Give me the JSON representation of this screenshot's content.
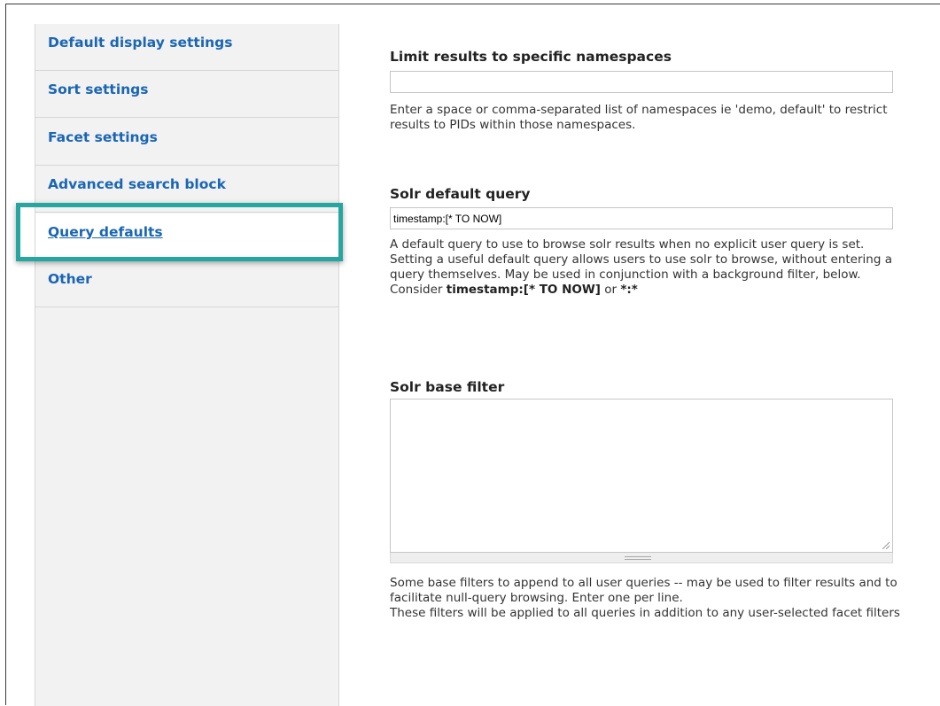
{
  "sidebar": {
    "items": [
      {
        "label": "Default display settings",
        "active": false
      },
      {
        "label": "Sort settings",
        "active": false
      },
      {
        "label": "Facet settings",
        "active": false
      },
      {
        "label": "Advanced search block",
        "active": false
      },
      {
        "label": "Query defaults",
        "active": true
      },
      {
        "label": "Other",
        "active": false
      }
    ],
    "highlight_color": "#27a6a1",
    "link_color": "#1a66b3"
  },
  "namespaces": {
    "label": "Limit results to specific namespaces",
    "value": "",
    "description": "Enter a space or comma-separated list of namespaces ie 'demo, default' to restrict results to PIDs within those namespaces."
  },
  "default_query": {
    "label": "Solr default query",
    "value": "timestamp:[* TO NOW]",
    "description": "A default query to use to browse solr results when no explicit user query is set. Setting a useful default query allows users to use solr to browse, without entering a query themselves. May be used in conjunction with a background filter, below.",
    "consider_prefix": "Consider ",
    "consider_example_1": "timestamp:[* TO NOW]",
    "consider_or": " or ",
    "consider_example_2": "*:*"
  },
  "base_filter": {
    "label": "Solr base filter",
    "value": "",
    "description_1": "Some base filters to append to all user queries -- may be used to filter results and to facilitate null-query browsing. Enter one per line.",
    "description_2": "These filters will be applied to all queries in addition to any user-selected facet filters"
  }
}
